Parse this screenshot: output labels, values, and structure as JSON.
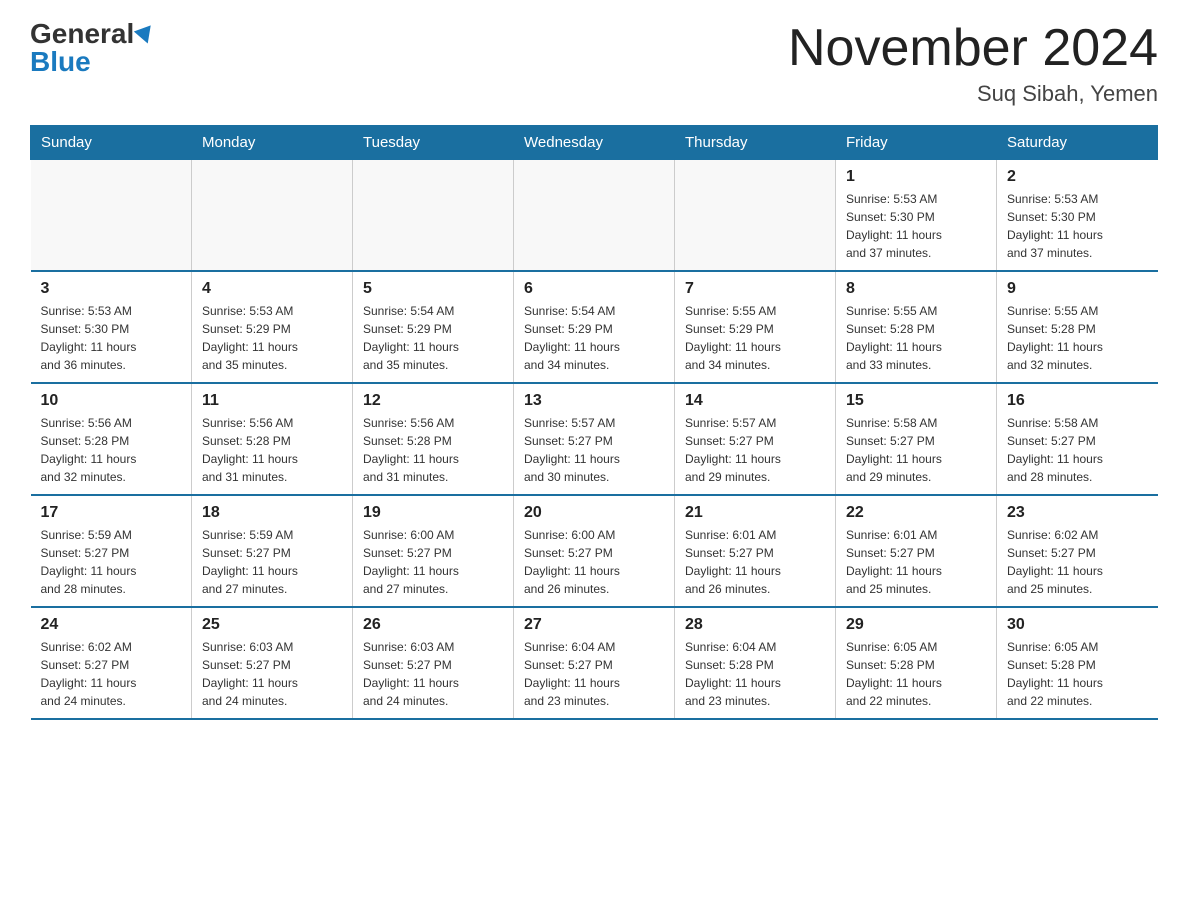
{
  "logo": {
    "general_text": "General",
    "blue_text": "Blue"
  },
  "title": "November 2024",
  "location": "Suq Sibah, Yemen",
  "days_of_week": [
    "Sunday",
    "Monday",
    "Tuesday",
    "Wednesday",
    "Thursday",
    "Friday",
    "Saturday"
  ],
  "weeks": [
    [
      {
        "day": "",
        "info": ""
      },
      {
        "day": "",
        "info": ""
      },
      {
        "day": "",
        "info": ""
      },
      {
        "day": "",
        "info": ""
      },
      {
        "day": "",
        "info": ""
      },
      {
        "day": "1",
        "info": "Sunrise: 5:53 AM\nSunset: 5:30 PM\nDaylight: 11 hours\nand 37 minutes."
      },
      {
        "day": "2",
        "info": "Sunrise: 5:53 AM\nSunset: 5:30 PM\nDaylight: 11 hours\nand 37 minutes."
      }
    ],
    [
      {
        "day": "3",
        "info": "Sunrise: 5:53 AM\nSunset: 5:30 PM\nDaylight: 11 hours\nand 36 minutes."
      },
      {
        "day": "4",
        "info": "Sunrise: 5:53 AM\nSunset: 5:29 PM\nDaylight: 11 hours\nand 35 minutes."
      },
      {
        "day": "5",
        "info": "Sunrise: 5:54 AM\nSunset: 5:29 PM\nDaylight: 11 hours\nand 35 minutes."
      },
      {
        "day": "6",
        "info": "Sunrise: 5:54 AM\nSunset: 5:29 PM\nDaylight: 11 hours\nand 34 minutes."
      },
      {
        "day": "7",
        "info": "Sunrise: 5:55 AM\nSunset: 5:29 PM\nDaylight: 11 hours\nand 34 minutes."
      },
      {
        "day": "8",
        "info": "Sunrise: 5:55 AM\nSunset: 5:28 PM\nDaylight: 11 hours\nand 33 minutes."
      },
      {
        "day": "9",
        "info": "Sunrise: 5:55 AM\nSunset: 5:28 PM\nDaylight: 11 hours\nand 32 minutes."
      }
    ],
    [
      {
        "day": "10",
        "info": "Sunrise: 5:56 AM\nSunset: 5:28 PM\nDaylight: 11 hours\nand 32 minutes."
      },
      {
        "day": "11",
        "info": "Sunrise: 5:56 AM\nSunset: 5:28 PM\nDaylight: 11 hours\nand 31 minutes."
      },
      {
        "day": "12",
        "info": "Sunrise: 5:56 AM\nSunset: 5:28 PM\nDaylight: 11 hours\nand 31 minutes."
      },
      {
        "day": "13",
        "info": "Sunrise: 5:57 AM\nSunset: 5:27 PM\nDaylight: 11 hours\nand 30 minutes."
      },
      {
        "day": "14",
        "info": "Sunrise: 5:57 AM\nSunset: 5:27 PM\nDaylight: 11 hours\nand 29 minutes."
      },
      {
        "day": "15",
        "info": "Sunrise: 5:58 AM\nSunset: 5:27 PM\nDaylight: 11 hours\nand 29 minutes."
      },
      {
        "day": "16",
        "info": "Sunrise: 5:58 AM\nSunset: 5:27 PM\nDaylight: 11 hours\nand 28 minutes."
      }
    ],
    [
      {
        "day": "17",
        "info": "Sunrise: 5:59 AM\nSunset: 5:27 PM\nDaylight: 11 hours\nand 28 minutes."
      },
      {
        "day": "18",
        "info": "Sunrise: 5:59 AM\nSunset: 5:27 PM\nDaylight: 11 hours\nand 27 minutes."
      },
      {
        "day": "19",
        "info": "Sunrise: 6:00 AM\nSunset: 5:27 PM\nDaylight: 11 hours\nand 27 minutes."
      },
      {
        "day": "20",
        "info": "Sunrise: 6:00 AM\nSunset: 5:27 PM\nDaylight: 11 hours\nand 26 minutes."
      },
      {
        "day": "21",
        "info": "Sunrise: 6:01 AM\nSunset: 5:27 PM\nDaylight: 11 hours\nand 26 minutes."
      },
      {
        "day": "22",
        "info": "Sunrise: 6:01 AM\nSunset: 5:27 PM\nDaylight: 11 hours\nand 25 minutes."
      },
      {
        "day": "23",
        "info": "Sunrise: 6:02 AM\nSunset: 5:27 PM\nDaylight: 11 hours\nand 25 minutes."
      }
    ],
    [
      {
        "day": "24",
        "info": "Sunrise: 6:02 AM\nSunset: 5:27 PM\nDaylight: 11 hours\nand 24 minutes."
      },
      {
        "day": "25",
        "info": "Sunrise: 6:03 AM\nSunset: 5:27 PM\nDaylight: 11 hours\nand 24 minutes."
      },
      {
        "day": "26",
        "info": "Sunrise: 6:03 AM\nSunset: 5:27 PM\nDaylight: 11 hours\nand 24 minutes."
      },
      {
        "day": "27",
        "info": "Sunrise: 6:04 AM\nSunset: 5:27 PM\nDaylight: 11 hours\nand 23 minutes."
      },
      {
        "day": "28",
        "info": "Sunrise: 6:04 AM\nSunset: 5:28 PM\nDaylight: 11 hours\nand 23 minutes."
      },
      {
        "day": "29",
        "info": "Sunrise: 6:05 AM\nSunset: 5:28 PM\nDaylight: 11 hours\nand 22 minutes."
      },
      {
        "day": "30",
        "info": "Sunrise: 6:05 AM\nSunset: 5:28 PM\nDaylight: 11 hours\nand 22 minutes."
      }
    ]
  ]
}
